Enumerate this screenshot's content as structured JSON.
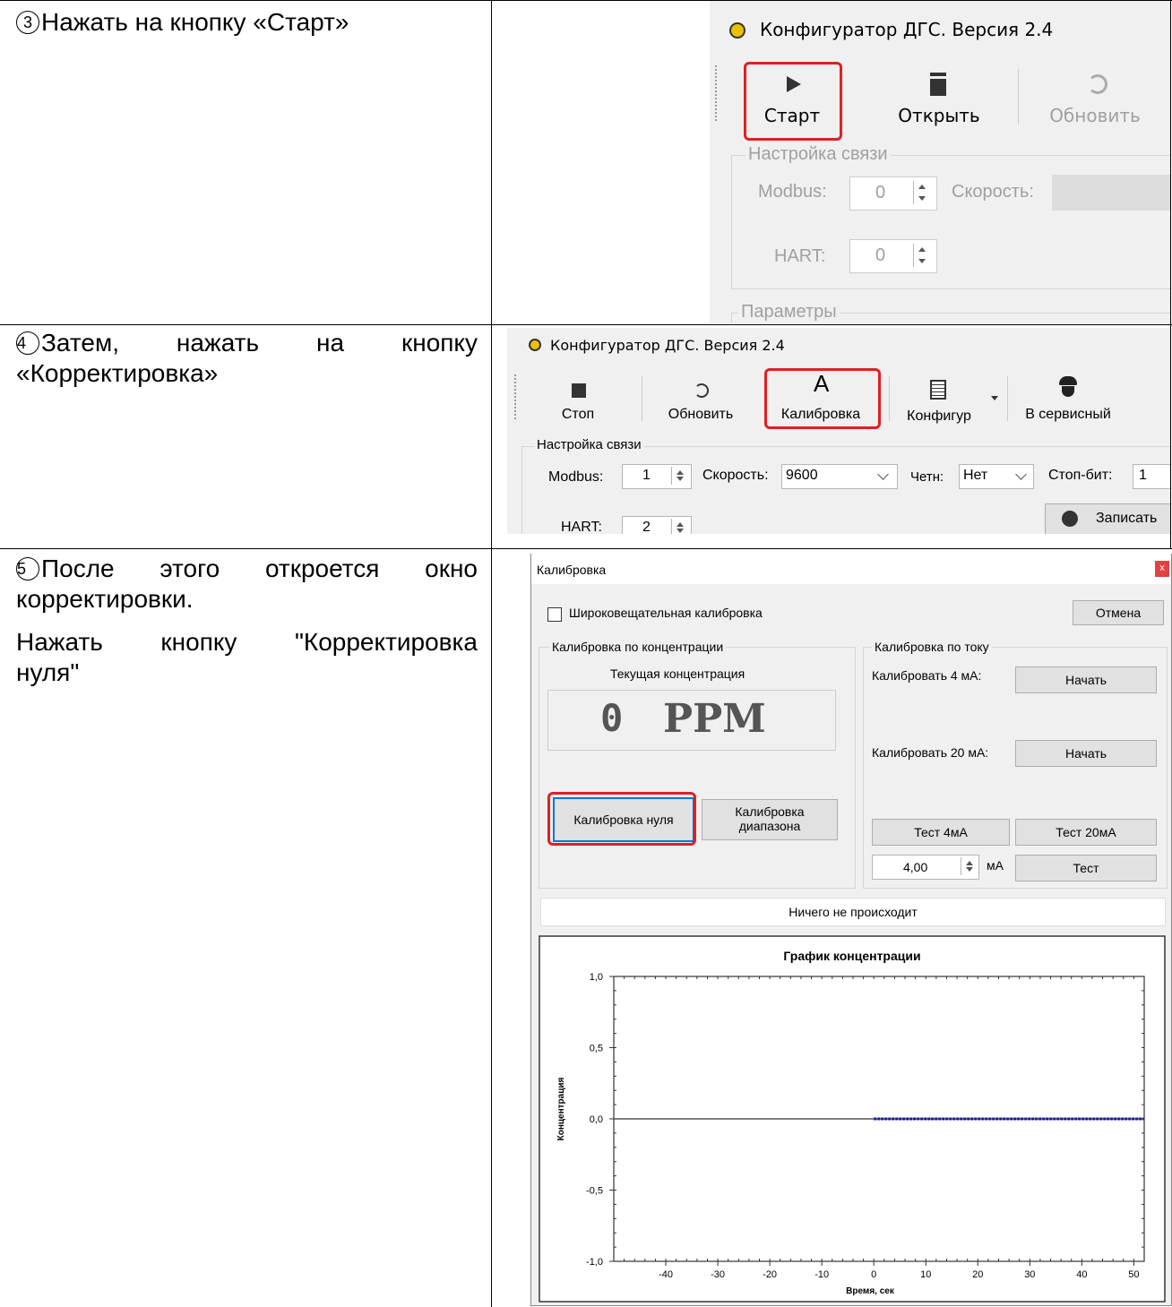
{
  "steps": [
    {
      "num": "3",
      "text": "Нажать на кнопку «Старт»"
    },
    {
      "num": "4",
      "line1": "Затем,  нажать  на  кнопку",
      "line2": "«Корректировка»"
    },
    {
      "num": "5",
      "line1": "После  этого  откроется  окно",
      "line2": "корректировки.",
      "line3": "Нажать  кнопку  \"Корректировка",
      "line4": "нуля\""
    }
  ],
  "shot1": {
    "title": "Конфигуратор ДГС. Версия 2.4",
    "start": "Старт",
    "open": "Открыть",
    "refresh": "Обновить",
    "group_comm": "Настройка связи",
    "modbus_label": "Modbus:",
    "modbus_value": "0",
    "speed_label": "Скорость:",
    "hart_label": "HART:",
    "hart_value": "0",
    "group_params": "Параметры"
  },
  "shot2": {
    "title": "Конфигуратор ДГС. Версия 2.4",
    "stop": "Стоп",
    "refresh": "Обновить",
    "calibration": "Калибровка",
    "config": "Конфигур",
    "service": "В сервисный",
    "group_comm": "Настройка связи",
    "modbus_label": "Modbus:",
    "modbus_value": "1",
    "speed_label": "Скорость:",
    "speed_value": "9600",
    "parity_label": "Четн:",
    "parity_value": "Нет",
    "stopbit_label": "Стоп-бит:",
    "stopbit_value": "1",
    "write": "Записать",
    "hart_label": "HART:",
    "hart_value": "2"
  },
  "shot3": {
    "title": "Калибровка",
    "close": "x",
    "broadcast": "Широковещательная калибровка",
    "cancel": "Отмена",
    "group_conc": "Калибровка по концентрации",
    "current_conc": "Текущая концентрация",
    "conc_value": "0",
    "conc_unit": "PPM",
    "zero_cal": "Калибровка нуля",
    "range_cal_1": "Калибровка",
    "range_cal_2": "диапазона",
    "group_current": "Калибровка по току",
    "cal4_label": "Калибровать 4 мА:",
    "cal4_btn": "Начать",
    "cal20_label": "Калибровать 20 мА:",
    "cal20_btn": "Начать",
    "test4": "Тест 4мА",
    "test20": "Тест 20мА",
    "ma_value": "4,00",
    "ma_unit": "мА",
    "test": "Тест",
    "status": "Ничего не происходит"
  },
  "chart_data": {
    "type": "line",
    "title": "График концентрации",
    "xlabel": "Время, сек",
    "ylabel": "Концентрация",
    "xlim": [
      -50,
      52
    ],
    "ylim": [
      -1.0,
      1.0
    ],
    "x_ticks": [
      "-40",
      "-30",
      "-20",
      "-10",
      "0",
      "10",
      "20",
      "30",
      "40",
      "50"
    ],
    "y_ticks": [
      "1,0",
      "0,5",
      "0,0",
      "-0,5",
      "-1,0"
    ],
    "series": [
      {
        "color": "#1a1aa0",
        "x": [
          0,
          52
        ],
        "y": [
          0,
          0
        ]
      }
    ],
    "grid": false
  }
}
